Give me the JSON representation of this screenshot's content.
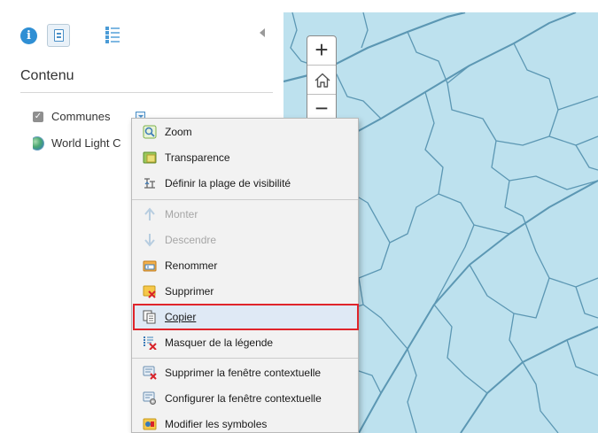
{
  "panel": {
    "tabs": [
      {
        "name": "info",
        "icon": "info-icon"
      },
      {
        "name": "content",
        "icon": "content-list-icon",
        "active": true
      },
      {
        "name": "legend",
        "icon": "legend-icon"
      }
    ],
    "collapse_icon": "collapse-left-icon",
    "title": "Contenu",
    "layers": [
      {
        "label": "Communes",
        "checked": true,
        "icon": "checkbox-icon",
        "has_options": true
      },
      {
        "label": "World Light Gray Base",
        "visible_label": "World Light C",
        "icon": "basemap-globe-icon"
      }
    ]
  },
  "map": {
    "background_color": "#bde1ee",
    "boundary_color": "#5c97b3",
    "controls": {
      "zoom_in": "+",
      "home": "home-icon",
      "zoom_out": "−"
    }
  },
  "context_menu": {
    "items": [
      {
        "label": "Zoom",
        "icon": "zoom-icon",
        "enabled": true
      },
      {
        "label": "Transparence",
        "icon": "transparency-icon",
        "enabled": true
      },
      {
        "label": "Définir la plage de visibilité",
        "icon": "visibility-range-icon",
        "enabled": true
      },
      {
        "label": "Monter",
        "icon": "arrow-up-icon",
        "enabled": false
      },
      {
        "label": "Descendre",
        "icon": "arrow-down-icon",
        "enabled": false
      },
      {
        "label": "Renommer",
        "icon": "rename-icon",
        "enabled": true
      },
      {
        "label": "Supprimer",
        "icon": "delete-icon",
        "enabled": true
      },
      {
        "label": "Copier",
        "icon": "copy-icon",
        "enabled": true,
        "highlighted": true
      },
      {
        "label": "Masquer de la légende",
        "icon": "hide-legend-icon",
        "enabled": true
      },
      {
        "label": "Supprimer la fenêtre contextuelle",
        "icon": "remove-popup-icon",
        "enabled": true
      },
      {
        "label": "Configurer la fenêtre contextuelle",
        "icon": "configure-popup-icon",
        "enabled": true
      },
      {
        "label": "Modifier les symboles",
        "icon": "change-symbols-icon",
        "enabled": true
      }
    ],
    "highlight_color": "#e0242b"
  }
}
